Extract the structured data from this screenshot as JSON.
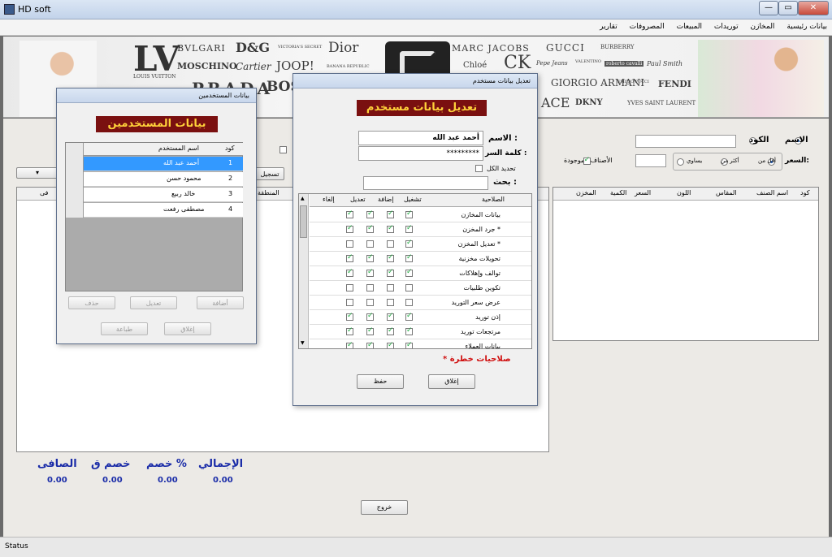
{
  "window": {
    "title": "HD soft",
    "minimize": "—",
    "maximize": "▭",
    "close": "✕"
  },
  "menu": [
    "بيانات رئيسية",
    "المخازن",
    "توريدات",
    "المبيعات",
    "المصروفات",
    "تقارير"
  ],
  "banner": {
    "brands_left": [
      "BVLGARI",
      "D&G",
      "VICTORIA'S SECRET",
      "Dior",
      "MOSCHINO",
      "Cartier",
      "JOOP!",
      "BANANA REPUBLIC",
      "PRADA",
      "BOSS",
      "LOUIS VUITTON"
    ],
    "brands_right": [
      "MARC JACOBS",
      "GUCCI",
      "BURBERRY",
      "Chloé",
      "CK",
      "Pepe Jeans",
      "VALENTINO",
      "roberto cavalli",
      "Paul Smith",
      "GIORGIO ARMANI",
      "EMILIO PUCCI",
      "FENDI",
      "ACE",
      "DKNY",
      "YVES SAINT LAURENT"
    ]
  },
  "search": {
    "name_label": "الاسم",
    "code_label": "الكود",
    "price_label": "السعر:",
    "less_label": "أقل من",
    "more_label": "أكثر من",
    "equal_label": "يساوي",
    "available_label": "الأصناف الموجودة",
    "register_btn": "تسجيل"
  },
  "items_table": {
    "headers": [
      "كود",
      "اسم الصنف",
      "المقاس",
      "اللون",
      "السعر",
      "الكمية",
      "المخزن"
    ]
  },
  "totals": {
    "labels": [
      "الإجمالي",
      "خصم %",
      "خصم ق",
      "الصافى"
    ],
    "values": [
      "0.00",
      "0.00",
      "0.00",
      "0.00"
    ]
  },
  "left_partial": {
    "header": "المنطقة",
    "col2": "فى"
  },
  "exit_button": "خروج",
  "status": "Status",
  "users_dialog": {
    "title": "بيانات المستخدمين",
    "heading": "بيانات المستخدمين",
    "col_code": "كود",
    "col_name": "اسم المستخدم",
    "rows": [
      {
        "code": "1",
        "name": "أحمد عبد الله"
      },
      {
        "code": "2",
        "name": "محمود حسن"
      },
      {
        "code": "3",
        "name": "خالد ربيع"
      },
      {
        "code": "4",
        "name": "مصطفى رفعت"
      }
    ],
    "btn_add": "أضافة",
    "btn_edit": "تعديل",
    "btn_delete": "حذف",
    "btn_close": "إغلاق",
    "btn_print": "طباعة"
  },
  "edit_dialog": {
    "title": "تعديل بيانات مستخدم",
    "heading": "تعديل بيانات مستخدم",
    "name_label": "الاسم :",
    "name_value": "أحمد عبد الله",
    "password_label": "كلمة السر :",
    "password_value": "*********",
    "select_all": "تحديد الكل",
    "search_label": "بحث :",
    "col_perm": "الصلاحية",
    "col_run": "تشغيل",
    "col_add": "إضافة",
    "col_edit": "تعديل",
    "col_cancel": "إلغاء",
    "perms": [
      {
        "name": "بيانات المخازن",
        "run": true,
        "add": true,
        "edit": true,
        "cancel": true
      },
      {
        "name": "جرد المخزن *",
        "run": true,
        "add": true,
        "edit": true,
        "cancel": true
      },
      {
        "name": "تعديل المخزن *",
        "run": true,
        "add": false,
        "edit": false,
        "cancel": false
      },
      {
        "name": "تحويلات مخزنية",
        "run": true,
        "add": true,
        "edit": true,
        "cancel": true
      },
      {
        "name": "توالف وإهلاكات",
        "run": true,
        "add": true,
        "edit": true,
        "cancel": true
      },
      {
        "name": "تكوين طلبيات",
        "run": false,
        "add": false,
        "edit": false,
        "cancel": false
      },
      {
        "name": "عرض سعر التوريد",
        "run": false,
        "add": false,
        "edit": false,
        "cancel": false
      },
      {
        "name": "إذن توريد",
        "run": true,
        "add": true,
        "edit": true,
        "cancel": true
      },
      {
        "name": "مرتجعات توريد",
        "run": true,
        "add": true,
        "edit": true,
        "cancel": true
      },
      {
        "name": "بيانات العملاء",
        "run": true,
        "add": true,
        "edit": true,
        "cancel": true
      }
    ],
    "dangerous_note": "* صلاحيات خطرة",
    "btn_close": "إغلاق",
    "btn_save": "حفظ"
  }
}
